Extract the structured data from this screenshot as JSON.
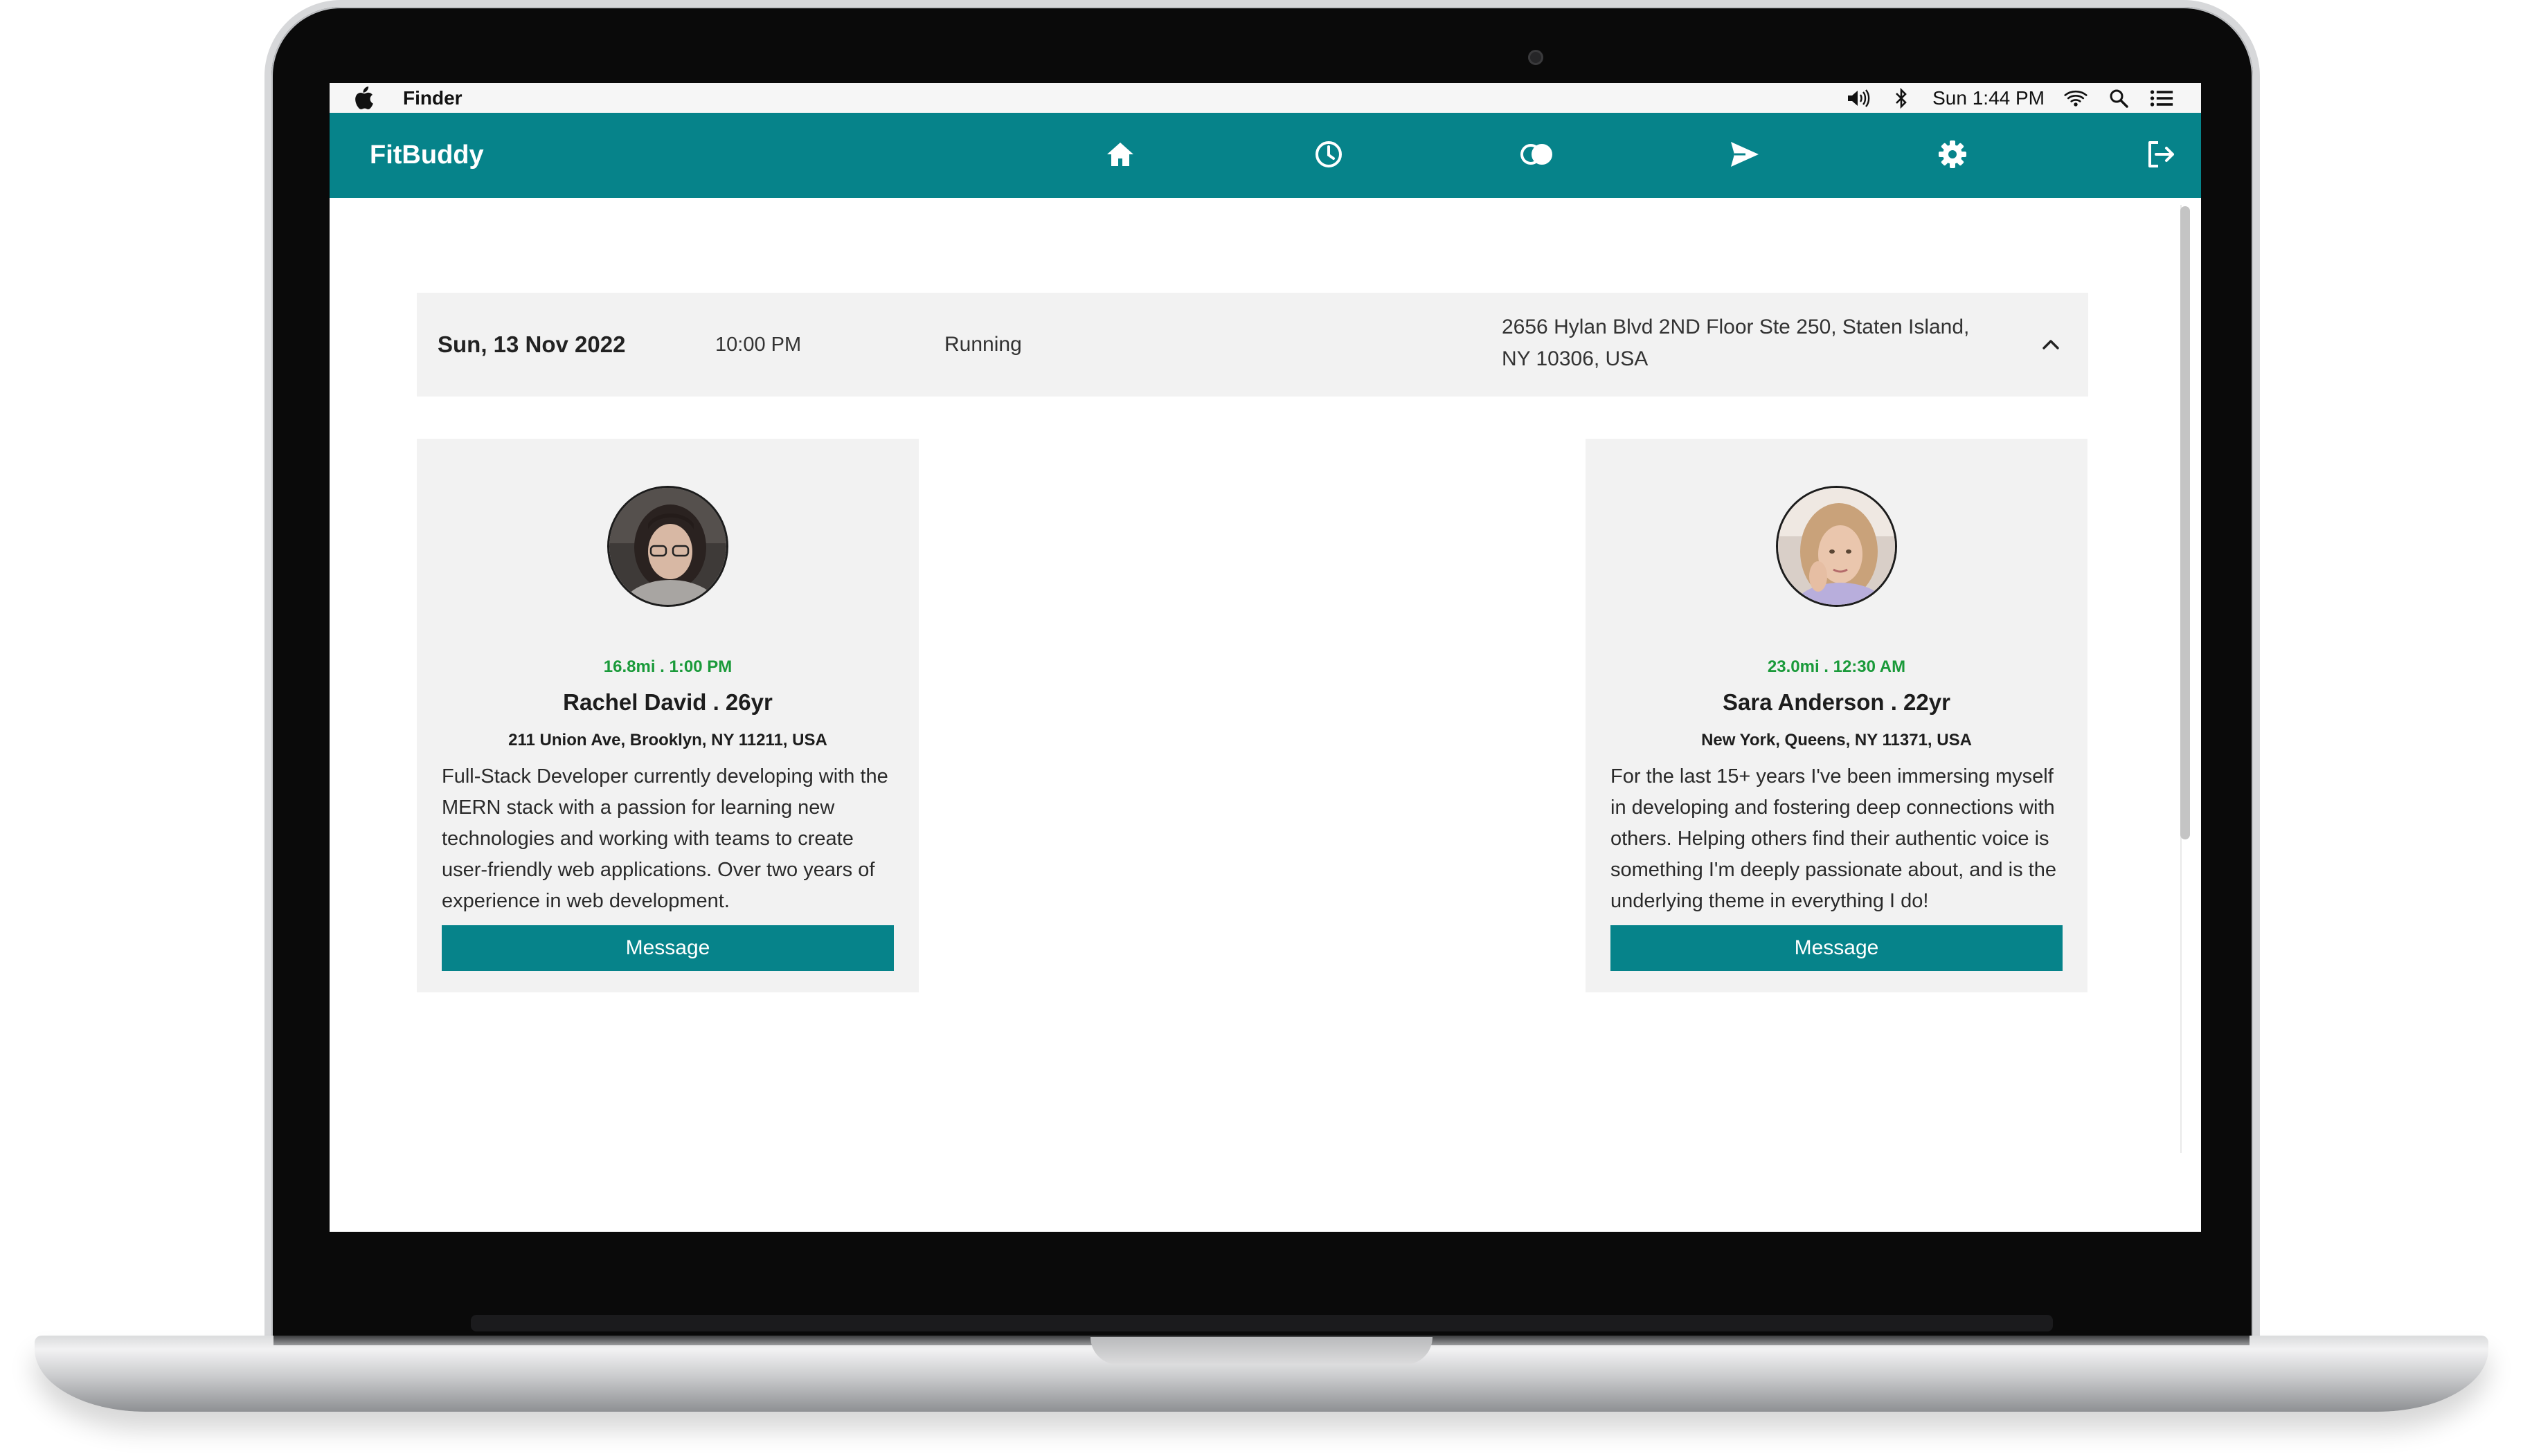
{
  "system_menubar": {
    "app_name": "Finder",
    "clock": "Sun 1:44 PM",
    "icons": [
      "apple-icon",
      "volume-icon",
      "bluetooth-icon",
      "wifi-icon",
      "search-icon",
      "list-icon"
    ]
  },
  "navbar": {
    "brand": "FitBuddy",
    "icons": [
      "home-icon",
      "clock-icon",
      "toggle-icon",
      "send-icon",
      "gear-icon",
      "logout-icon"
    ],
    "accent_color": "#06838a"
  },
  "event": {
    "date": "Sun, 13 Nov 2022",
    "time": "10:00 PM",
    "activity": "Running",
    "address": "2656 Hylan Blvd 2ND Floor Ste 250, Staten Island, NY 10306, USA",
    "expanded": true
  },
  "buddies": [
    {
      "meta": "16.8mi . 1:00 PM",
      "name": "Rachel David . 26yr",
      "location": "211 Union Ave, Brooklyn, NY 11211, USA",
      "bio": "Full-Stack Developer currently developing with the MERN stack with a passion for learning new technologies and working with teams to create user-friendly web applications. Over two years of experience in web development.",
      "button": "Message"
    },
    {
      "meta": "23.0mi . 12:30 AM",
      "name": "Sara Anderson . 22yr",
      "location": "New York, Queens, NY 11371, USA",
      "bio": "For the last 15+ years I've been immersing myself in developing and fostering deep connections with others. Helping others find their authentic voice is something I'm deeply passionate about, and is the underlying theme in everything I do!",
      "button": "Message"
    }
  ],
  "colors": {
    "meta_green": "#1a9a3a",
    "card_bg": "#f2f2f2"
  }
}
